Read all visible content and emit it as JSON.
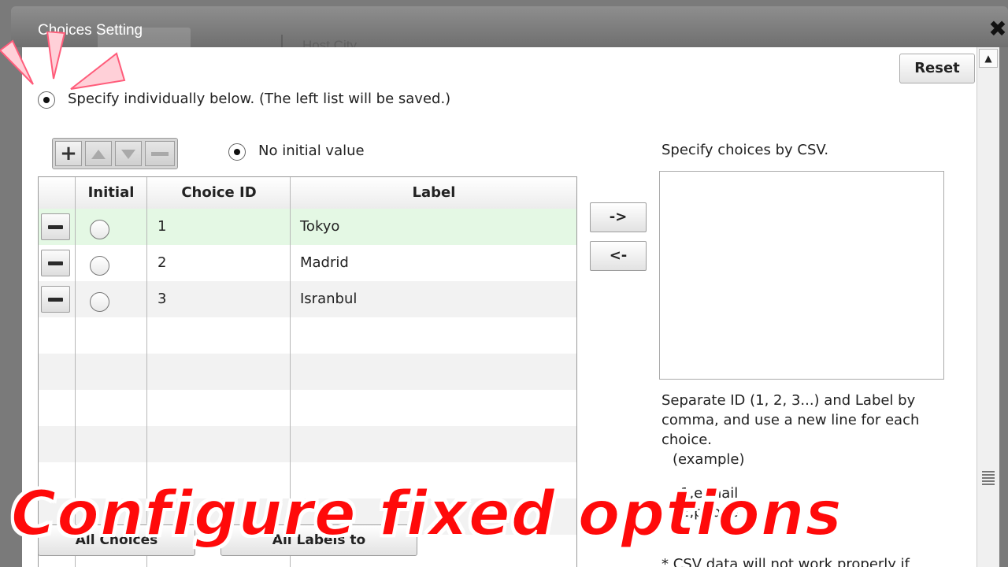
{
  "window": {
    "title": "Choices Setting",
    "close_label": "✖",
    "background_tab": "Host City"
  },
  "reset_label": "Reset",
  "mode": {
    "individual_label": "Specify individually below. (The left list will be saved.)",
    "individual_selected": true
  },
  "toolbar": {
    "add_icon": "plus-icon",
    "up_icon": "up-arrow-icon",
    "down_icon": "down-arrow-icon",
    "remove_icon": "minus-icon"
  },
  "no_initial": {
    "label": "No initial value",
    "selected": true
  },
  "table": {
    "headers": [
      "Initial",
      "Choice ID",
      "Label"
    ],
    "rows": [
      {
        "id": "1",
        "label": "Tokyo",
        "selected": true
      },
      {
        "id": "2",
        "label": "Madrid",
        "selected": false
      },
      {
        "id": "3",
        "label": "Isranbul",
        "selected": false
      }
    ]
  },
  "transfer": {
    "to_csv": "->",
    "from_csv": "<-"
  },
  "csv": {
    "heading": "Specify choices by CSV.",
    "value": "",
    "help_lines": [
      "Separate ID (1, 2, 3...) and Label by",
      "comma, and use a new line for each",
      "choice.",
      "  (example)"
    ],
    "example_lines": [
      "1,e-mail",
      "2,phone"
    ],
    "note": "* CSV data will not work properly if"
  },
  "bottom_buttons": [
    "All Choices",
    "All Labels to"
  ],
  "caption": "Configure fixed options",
  "colors": {
    "selected_row": "#e4f8e4",
    "caption_red": "#ff0a0a",
    "pointer_fill": "#ffd0d8"
  }
}
